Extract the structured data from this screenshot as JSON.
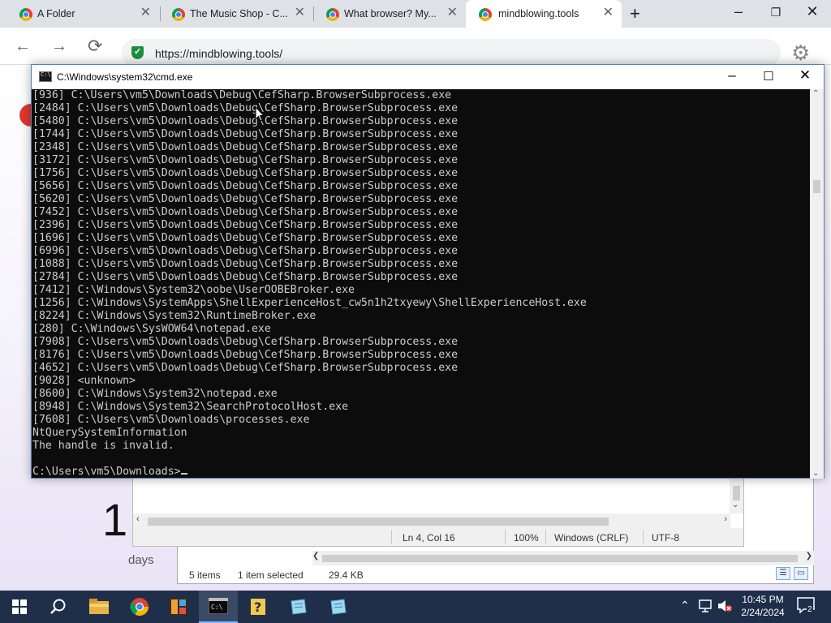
{
  "browser": {
    "tabs": [
      {
        "label": "A Folder",
        "active": false
      },
      {
        "label": "The Music Shop - C...",
        "active": false
      },
      {
        "label": "What browser? My...",
        "active": false
      },
      {
        "label": "mindblowing.tools",
        "active": true
      }
    ],
    "new_tab": "+",
    "url": "https://mindblowing.tools/"
  },
  "webpage": {
    "big_number": "1",
    "days_label": "days"
  },
  "cmd_window": {
    "title": "C:\\Windows\\system32\\cmd.exe",
    "lines": [
      "[936] C:\\Users\\vm5\\Downloads\\Debug\\CefSharp.BrowserSubprocess.exe",
      "[2484] C:\\Users\\vm5\\Downloads\\Debug\\CefSharp.BrowserSubprocess.exe",
      "[5480] C:\\Users\\vm5\\Downloads\\Debug\\CefSharp.BrowserSubprocess.exe",
      "[1744] C:\\Users\\vm5\\Downloads\\Debug\\CefSharp.BrowserSubprocess.exe",
      "[2348] C:\\Users\\vm5\\Downloads\\Debug\\CefSharp.BrowserSubprocess.exe",
      "[3172] C:\\Users\\vm5\\Downloads\\Debug\\CefSharp.BrowserSubprocess.exe",
      "[1756] C:\\Users\\vm5\\Downloads\\Debug\\CefSharp.BrowserSubprocess.exe",
      "[5656] C:\\Users\\vm5\\Downloads\\Debug\\CefSharp.BrowserSubprocess.exe",
      "[5620] C:\\Users\\vm5\\Downloads\\Debug\\CefSharp.BrowserSubprocess.exe",
      "[7452] C:\\Users\\vm5\\Downloads\\Debug\\CefSharp.BrowserSubprocess.exe",
      "[2396] C:\\Users\\vm5\\Downloads\\Debug\\CefSharp.BrowserSubprocess.exe",
      "[1696] C:\\Users\\vm5\\Downloads\\Debug\\CefSharp.BrowserSubprocess.exe",
      "[6996] C:\\Users\\vm5\\Downloads\\Debug\\CefSharp.BrowserSubprocess.exe",
      "[1088] C:\\Users\\vm5\\Downloads\\Debug\\CefSharp.BrowserSubprocess.exe",
      "[2784] C:\\Users\\vm5\\Downloads\\Debug\\CefSharp.BrowserSubprocess.exe",
      "[7412] C:\\Windows\\System32\\oobe\\UserOOBEBroker.exe",
      "[1256] C:\\Windows\\SystemApps\\ShellExperienceHost_cw5n1h2txyewy\\ShellExperienceHost.exe",
      "[8224] C:\\Windows\\System32\\RuntimeBroker.exe",
      "[280] C:\\Windows\\SysWOW64\\notepad.exe",
      "[7908] C:\\Users\\vm5\\Downloads\\Debug\\CefSharp.BrowserSubprocess.exe",
      "[8176] C:\\Users\\vm5\\Downloads\\Debug\\CefSharp.BrowserSubprocess.exe",
      "[4652] C:\\Users\\vm5\\Downloads\\Debug\\CefSharp.BrowserSubprocess.exe",
      "[9028] <unknown>",
      "[8600] C:\\Windows\\System32\\notepad.exe",
      "[8948] C:\\Windows\\System32\\SearchProtocolHost.exe",
      "[7608] C:\\Users\\vm5\\Downloads\\processes.exe",
      "NtQuerySystemInformation",
      "The handle is invalid.",
      ""
    ],
    "prompt": "C:\\Users\\vm5\\Downloads>"
  },
  "notepad": {
    "status": {
      "position": "Ln 4, Col 16",
      "zoom": "100%",
      "line_endings": "Windows (CRLF)",
      "encoding": "UTF-8"
    }
  },
  "explorer": {
    "status": {
      "item_count": "5 items",
      "selection": "1 item selected",
      "size": "29.4 KB"
    }
  },
  "taskbar": {
    "clock_time": "10:45 PM",
    "clock_date": "2/24/2024",
    "notification_count": "2"
  },
  "colors": {
    "console_bg": "#0c0c0c",
    "console_fg": "#cccccc",
    "taskbar_bg": "#1f2f4a",
    "secure_green": "#1e8e3e"
  },
  "icons": {
    "back": "arrow-left-icon",
    "forward": "arrow-right-icon",
    "reload": "reload-icon",
    "settings": "gear-icon"
  }
}
